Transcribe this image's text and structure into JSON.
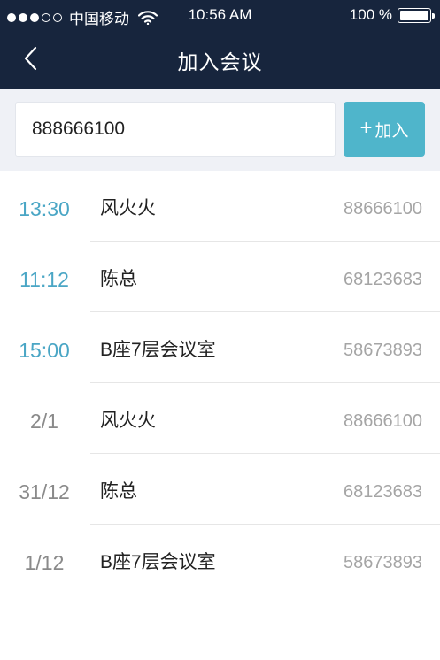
{
  "status_bar": {
    "carrier": "中国移动",
    "time": "10:56 AM",
    "battery": "100 %"
  },
  "nav": {
    "title": "加入会议"
  },
  "search": {
    "value": "888666100",
    "join_label": "加入"
  },
  "icons": {
    "back": "back-chevron-icon",
    "plus": "plus-icon",
    "wifi": "wifi-icon",
    "battery": "battery-icon",
    "signal": "signal-dots-icon"
  },
  "colors": {
    "header_bg": "#17253d",
    "accent": "#4fb5cb",
    "recent_time": "#4aa6c5"
  },
  "meetings": [
    {
      "time": "13:30",
      "name": "风火火",
      "number": "88666100"
    },
    {
      "time": "11:12",
      "name": "陈总",
      "number": "68123683"
    },
    {
      "time": "15:00",
      "name": "B座7层会议室",
      "number": "58673893"
    },
    {
      "time": "2/1",
      "name": "风火火",
      "number": "88666100"
    },
    {
      "time": "31/12",
      "name": "陈总",
      "number": "68123683"
    },
    {
      "time": "1/12",
      "name": "B座7层会议室",
      "number": "58673893"
    }
  ]
}
